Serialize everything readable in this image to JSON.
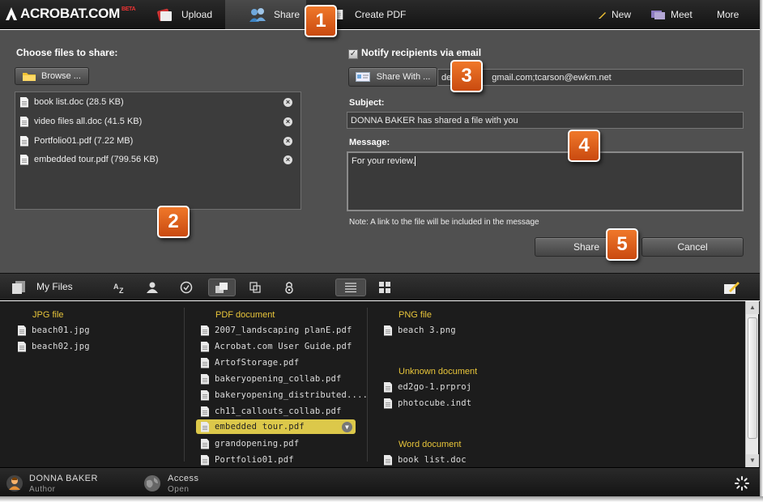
{
  "topbar": {
    "logo": "ACROBAT.COM",
    "logo_beta": "BETA",
    "tabs": [
      {
        "label": "Upload",
        "icon": "upload-icon"
      },
      {
        "label": "Share",
        "icon": "share-icon"
      },
      {
        "label": "Create PDF",
        "icon": "create-pdf-icon"
      }
    ],
    "right": [
      {
        "label": "New",
        "icon": "pencil-icon"
      },
      {
        "label": "Meet",
        "icon": "meet-icon"
      },
      {
        "label": "More",
        "icon": ""
      }
    ]
  },
  "share": {
    "choose_label": "Choose files to share:",
    "browse_label": "Browse ...",
    "files": [
      "book list.doc (28.5 KB)",
      "video files all.doc (41.5 KB)",
      "Portfolio01.pdf (7.22 MB)",
      "embedded tour.pdf (799.56 KB)"
    ],
    "notify_label": "Notify recipients via email",
    "notify_checked": true,
    "share_with_label": "Share With ...",
    "recipients_value": "de[obscured]gmail.com;tcarson@ewkm.net",
    "recipients_visible_start": "de",
    "recipients_visible_end": "gmail.com;tcarson@ewkm.net",
    "subject_label": "Subject:",
    "subject_value": "DONNA BAKER has shared a file with you",
    "message_label": "Message:",
    "message_value": "For your review.",
    "note": "Note: A link to the file will be included in the message",
    "share_button": "Share",
    "cancel_button": "Cancel"
  },
  "callouts": [
    "1",
    "2",
    "3",
    "4",
    "5"
  ],
  "myfiles": {
    "title": "My Files",
    "toolbar_icons": [
      "sort-az-icon",
      "user-icon",
      "clock-icon",
      "share-files-icon",
      "copy-icon",
      "lock-icon",
      "list-view-icon",
      "grid-view-icon",
      "edit-icon"
    ],
    "columns": [
      {
        "groups": [
          {
            "category": "JPG file",
            "items": [
              "beach01.jpg",
              "beach02.jpg"
            ]
          }
        ]
      },
      {
        "groups": [
          {
            "category": "PDF document",
            "items": [
              "2007_landscaping planE.pdf",
              "Acrobat.com User Guide.pdf",
              "ArtofStorage.pdf",
              "bakeryopening_collab.pdf",
              "bakeryopening_distributed....",
              "ch11_callouts_collab.pdf",
              "embedded tour.pdf",
              "grandopening.pdf",
              "Portfolio01.pdf"
            ]
          }
        ]
      },
      {
        "groups": [
          {
            "category": "PNG file",
            "items": [
              "beach 3.png"
            ]
          },
          {
            "category": "Unknown document",
            "items": [
              "ed2go-1.prproj",
              "photocube.indt"
            ]
          },
          {
            "category": "Word document",
            "items": [
              "book list.doc"
            ]
          }
        ]
      }
    ],
    "selected_item": "embedded tour.pdf"
  },
  "status": {
    "user_name": "DONNA BAKER",
    "user_role": "Author",
    "access_label": "Access",
    "access_value": "Open"
  },
  "colors": {
    "panel_bg": "#505050",
    "callout": "#e0601e",
    "category": "#e8c53a",
    "highlight": "#dcc84a"
  }
}
